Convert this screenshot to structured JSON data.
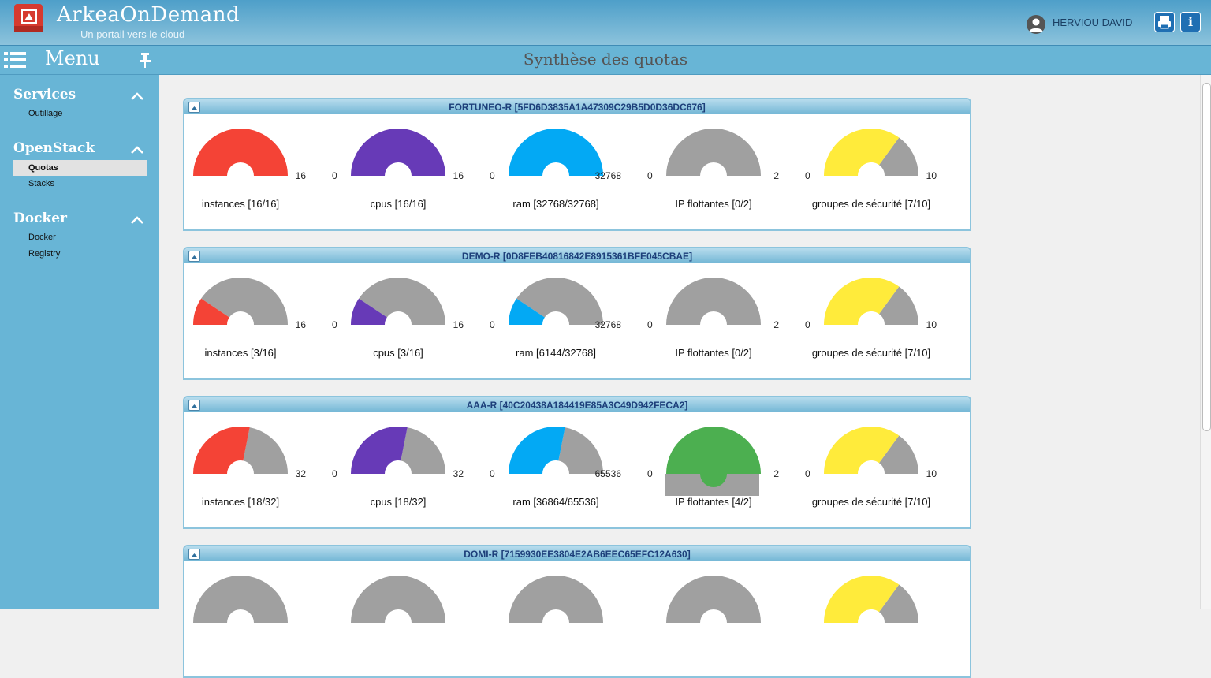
{
  "app": {
    "title": "ArkeaOnDemand",
    "subtitle": "Un portail vers le cloud",
    "user": "HERVIOU DAVID",
    "info_label": "i"
  },
  "menubar": {
    "menu_label": "Menu",
    "page_title": "Synthèse des quotas"
  },
  "sidebar": {
    "sections": [
      {
        "title": "Services",
        "items": [
          "Outillage"
        ]
      },
      {
        "title": "OpenStack",
        "items": [
          "Quotas",
          "Stacks"
        ]
      },
      {
        "title": "Docker",
        "items": [
          "Docker",
          "Registry"
        ]
      }
    ],
    "active_item": "Quotas"
  },
  "colors": {
    "instances": "#f44336",
    "cpus": "#673ab7",
    "ram": "#03a9f4",
    "ip": "#4caf50",
    "secgroups": "#ffeb3b",
    "remaining": "#a0a0a0"
  },
  "projects": [
    {
      "title": "FORTUNEO-R [5FD6D3835A1A47309C29B5D0D36DC676]",
      "gauges": [
        {
          "key": "instances",
          "label": "instances [16/16]",
          "min": "0",
          "max": "16",
          "used": 16,
          "total": 16
        },
        {
          "key": "cpus",
          "label": "cpus [16/16]",
          "min": "0",
          "max": "16",
          "used": 16,
          "total": 16
        },
        {
          "key": "ram",
          "label": "ram [32768/32768]",
          "min": "0",
          "max": "32768",
          "used": 32768,
          "total": 32768
        },
        {
          "key": "ip",
          "label": "IP flottantes [0/2]",
          "min": "0",
          "max": "2",
          "used": 0,
          "total": 2
        },
        {
          "key": "secgroups",
          "label": "groupes de sécurité [7/10]",
          "min": "0",
          "max": "10",
          "used": 7,
          "total": 10
        }
      ]
    },
    {
      "title": "DEMO-R [0D8FEB40816842E8915361BFE045CBAE]",
      "gauges": [
        {
          "key": "instances",
          "label": "instances [3/16]",
          "min": "0",
          "max": "16",
          "used": 3,
          "total": 16
        },
        {
          "key": "cpus",
          "label": "cpus [3/16]",
          "min": "0",
          "max": "16",
          "used": 3,
          "total": 16
        },
        {
          "key": "ram",
          "label": "ram [6144/32768]",
          "min": "0",
          "max": "32768",
          "used": 6144,
          "total": 32768
        },
        {
          "key": "ip",
          "label": "IP flottantes [0/2]",
          "min": "0",
          "max": "2",
          "used": 0,
          "total": 2
        },
        {
          "key": "secgroups",
          "label": "groupes de sécurité [7/10]",
          "min": "0",
          "max": "10",
          "used": 7,
          "total": 10
        }
      ]
    },
    {
      "title": "AAA-R [40C20438A184419E85A3C49D942FECA2]",
      "gauges": [
        {
          "key": "instances",
          "label": "instances [18/32]",
          "min": "0",
          "max": "32",
          "used": 18,
          "total": 32
        },
        {
          "key": "cpus",
          "label": "cpus [18/32]",
          "min": "0",
          "max": "32",
          "used": 18,
          "total": 32
        },
        {
          "key": "ram",
          "label": "ram [36864/65536]",
          "min": "0",
          "max": "65536",
          "used": 36864,
          "total": 65536
        },
        {
          "key": "ip",
          "label": "IP flottantes [4/2]",
          "min": "0",
          "max": "2",
          "used": 4,
          "total": 2
        },
        {
          "key": "secgroups",
          "label": "groupes de sécurité [7/10]",
          "min": "0",
          "max": "10",
          "used": 7,
          "total": 10
        }
      ]
    },
    {
      "title": "DOMI-R [7159930EE3804E2AB6EEC65EFC12A630]",
      "gauges": [
        {
          "key": "instances",
          "label": "",
          "min": "",
          "max": "",
          "used": 0,
          "total": 1
        },
        {
          "key": "cpus",
          "label": "",
          "min": "",
          "max": "",
          "used": 0,
          "total": 1
        },
        {
          "key": "ram",
          "label": "",
          "min": "",
          "max": "",
          "used": 0,
          "total": 1
        },
        {
          "key": "ip",
          "label": "",
          "min": "",
          "max": "",
          "used": 0,
          "total": 1
        },
        {
          "key": "secgroups",
          "label": "",
          "min": "",
          "max": "",
          "used": 7,
          "total": 10
        }
      ]
    }
  ]
}
